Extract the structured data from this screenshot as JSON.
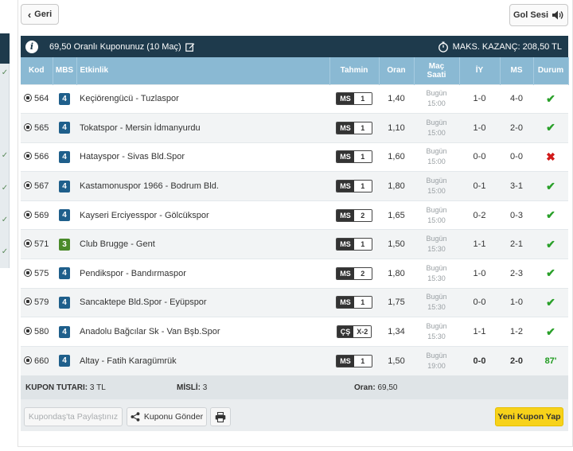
{
  "nav": {
    "back_label": "Geri",
    "sound_label": "Gol Sesi"
  },
  "coupon": {
    "title": "69,50 Oranlı Kuponunuz (10 Maç)",
    "max_win": "MAKS. KAZANÇ: 208,50 TL"
  },
  "table": {
    "headers": {
      "code": "Kod",
      "mbs": "MBS",
      "event": "Etkinlik",
      "tahmin": "Tahmin",
      "oran": "Oran",
      "mac_saati_1": "Maç",
      "mac_saati_2": "Saati",
      "iy": "İY",
      "ms": "MS",
      "durum": "Durum"
    },
    "rows": [
      {
        "code": "564",
        "mbs": "4",
        "event": "Keçiörengücü - Tuzlaspor",
        "bet_type": "MS",
        "bet_value": "1",
        "odds": "1,40",
        "day": "Bugün",
        "time": "15:00",
        "ht": "1-0",
        "ft": "4-0",
        "status": "✔"
      },
      {
        "code": "565",
        "mbs": "4",
        "event": "Tokatspor - Mersin İdmanyurdu",
        "bet_type": "MS",
        "bet_value": "1",
        "odds": "1,10",
        "day": "Bugün",
        "time": "15:00",
        "ht": "1-0",
        "ft": "2-0",
        "status": "✔"
      },
      {
        "code": "566",
        "mbs": "4",
        "event": "Hatayspor - Sivas Bld.Spor",
        "bet_type": "MS",
        "bet_value": "1",
        "odds": "1,60",
        "day": "Bugün",
        "time": "15:00",
        "ht": "0-0",
        "ft": "0-0",
        "status": "✖"
      },
      {
        "code": "567",
        "mbs": "4",
        "event": "Kastamonuspor 1966 - Bodrum Bld.",
        "bet_type": "MS",
        "bet_value": "1",
        "odds": "1,80",
        "day": "Bugün",
        "time": "15:00",
        "ht": "0-1",
        "ft": "3-1",
        "status": "✔"
      },
      {
        "code": "569",
        "mbs": "4",
        "event": "Kayseri Erciyesspor - Gölcükspor",
        "bet_type": "MS",
        "bet_value": "2",
        "odds": "1,65",
        "day": "Bugün",
        "time": "15:00",
        "ht": "0-2",
        "ft": "0-3",
        "status": "✔"
      },
      {
        "code": "571",
        "mbs": "3",
        "event": "Club Brugge - Gent",
        "bet_type": "MS",
        "bet_value": "1",
        "odds": "1,50",
        "day": "Bugün",
        "time": "15:30",
        "ht": "1-1",
        "ft": "2-1",
        "status": "✔"
      },
      {
        "code": "575",
        "mbs": "4",
        "event": "Pendikspor - Bandırmaspor",
        "bet_type": "MS",
        "bet_value": "2",
        "odds": "1,80",
        "day": "Bugün",
        "time": "15:30",
        "ht": "1-0",
        "ft": "2-3",
        "status": "✔"
      },
      {
        "code": "579",
        "mbs": "4",
        "event": "Sancaktepe Bld.Spor - Eyüpspor",
        "bet_type": "MS",
        "bet_value": "1",
        "odds": "1,75",
        "day": "Bugün",
        "time": "15:30",
        "ht": "0-0",
        "ft": "1-0",
        "status": "✔"
      },
      {
        "code": "580",
        "mbs": "4",
        "event": "Anadolu Bağcılar Sk - Van Bşb.Spor",
        "bet_type": "ÇŞ",
        "bet_value": "X-2",
        "odds": "1,34",
        "day": "Bugün",
        "time": "15:30",
        "ht": "1-1",
        "ft": "1-2",
        "status": "✔"
      },
      {
        "code": "660",
        "mbs": "4",
        "event": "Altay - Fatih Karagümrük",
        "bet_type": "MS",
        "bet_value": "1",
        "odds": "1,50",
        "day": "Bugün",
        "time": "19:00",
        "ht": "0-0",
        "ft": "2-0",
        "status": "87'"
      }
    ]
  },
  "summary": {
    "amount_label": "KUPON TUTARI:",
    "amount_value": "3 TL",
    "multiplier_label": "MİSLİ:",
    "multiplier_value": "3",
    "odds_label": "Oran:",
    "odds_value": "69,50"
  },
  "footer": {
    "share_label": "Kupondaş'ta Paylaştınız",
    "send_label": "Kuponu Gönder",
    "new_label": "Yeni Kupon Yap"
  },
  "colors": {
    "header_bg": "#1e3a4c",
    "table_header_bg": "#8ab9d3",
    "mbs_4": "#1f5f8b",
    "mbs_3": "#4a8a2a",
    "success": "#2aa02a",
    "fail": "#d11a1a",
    "accent_yellow": "#f7d21a"
  },
  "icons": {
    "back": "chevron-left-icon",
    "sound": "speaker-icon",
    "info": "info-icon",
    "edit": "edit-icon",
    "max_win": "stopwatch-icon",
    "ball": "football-icon",
    "share": "share-icon",
    "print": "printer-icon"
  }
}
